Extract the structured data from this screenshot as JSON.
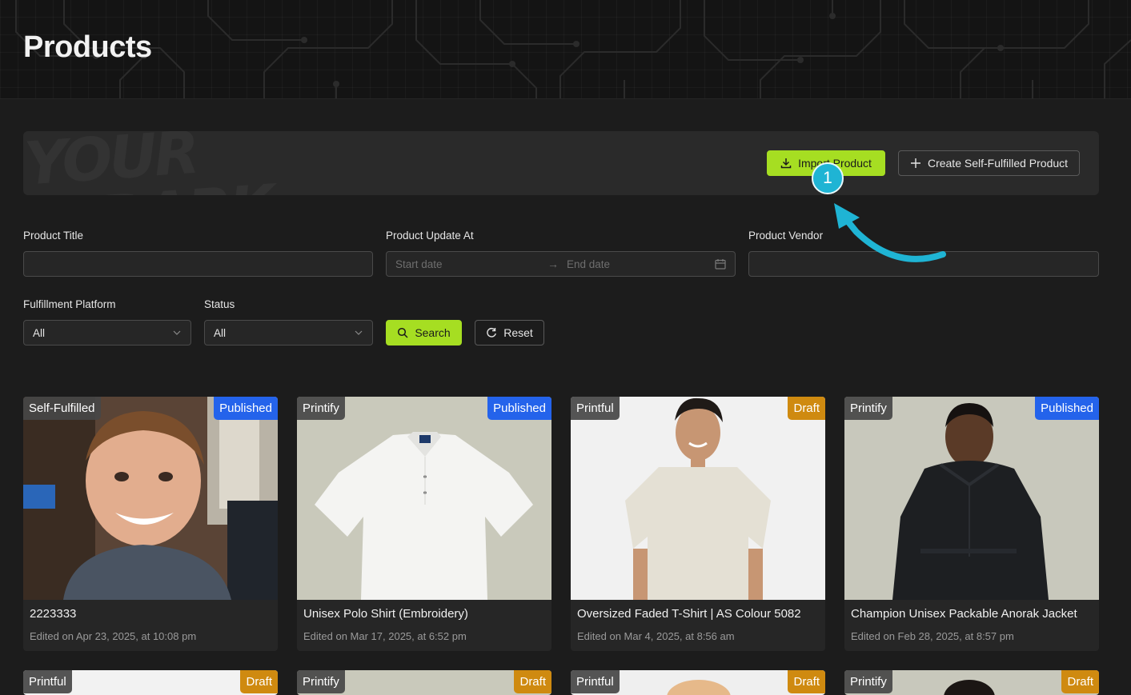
{
  "header": {
    "title": "Products"
  },
  "banner": {
    "logo_text": "YOUR DARK",
    "import_label": "Import Product",
    "create_label": "Create Self-Fulfilled Product"
  },
  "filters": {
    "product_title_label": "Product Title",
    "product_title_value": "",
    "update_at_label": "Product Update At",
    "start_placeholder": "Start date",
    "end_placeholder": "End date",
    "vendor_label": "Product Vendor",
    "vendor_value": "",
    "platform_label": "Fulfillment Platform",
    "platform_value": "All",
    "status_label": "Status",
    "status_value": "All",
    "search_label": "Search",
    "reset_label": "Reset"
  },
  "annotation": {
    "step": "1"
  },
  "products": [
    {
      "platform": "Self-Fulfilled",
      "status": "Published",
      "title": "2223333",
      "edited": "Edited on Apr 23, 2025, at 10:08 pm"
    },
    {
      "platform": "Printify",
      "status": "Published",
      "title": "Unisex Polo Shirt (Embroidery)",
      "edited": "Edited on Mar 17, 2025, at 6:52 pm"
    },
    {
      "platform": "Printful",
      "status": "Draft",
      "title": "Oversized Faded T-Shirt | AS Colour 5082",
      "edited": "Edited on Mar 4, 2025, at 8:56 am"
    },
    {
      "platform": "Printify",
      "status": "Published",
      "title": "Champion Unisex Packable Anorak Jacket",
      "edited": "Edited on Feb 28, 2025, at 8:57 pm"
    },
    {
      "platform": "Printful",
      "status": "Draft"
    },
    {
      "platform": "Printify",
      "status": "Draft"
    },
    {
      "platform": "Printful",
      "status": "Draft"
    },
    {
      "platform": "Printify",
      "status": "Draft"
    }
  ],
  "colors": {
    "accent": "#a6de22",
    "published": "#2463eb",
    "draft": "#cf8a10",
    "annotation": "#1fb4d4"
  }
}
